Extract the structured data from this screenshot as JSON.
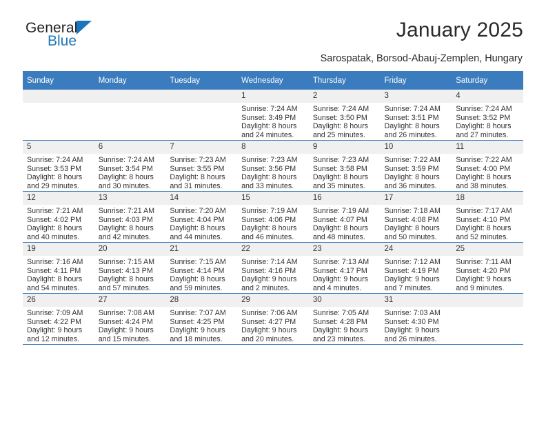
{
  "logo": {
    "word_top": "General",
    "word_bottom": "Blue",
    "triangle_color": "#1b75bb"
  },
  "header": {
    "title": "January 2025",
    "subtitle": "Sarospatak, Borsod-Abauj-Zemplen, Hungary"
  },
  "theme": {
    "header_bg": "#3b7cbe",
    "daynum_bg": "#f0f0f0",
    "text": "#333333"
  },
  "weekday_headers": [
    "Sunday",
    "Monday",
    "Tuesday",
    "Wednesday",
    "Thursday",
    "Friday",
    "Saturday"
  ],
  "weeks": [
    [
      {
        "day": "",
        "sunrise": "",
        "sunset": "",
        "daylight1": "",
        "daylight2": ""
      },
      {
        "day": "",
        "sunrise": "",
        "sunset": "",
        "daylight1": "",
        "daylight2": ""
      },
      {
        "day": "",
        "sunrise": "",
        "sunset": "",
        "daylight1": "",
        "daylight2": ""
      },
      {
        "day": "1",
        "sunrise": "Sunrise: 7:24 AM",
        "sunset": "Sunset: 3:49 PM",
        "daylight1": "Daylight: 8 hours",
        "daylight2": "and 24 minutes."
      },
      {
        "day": "2",
        "sunrise": "Sunrise: 7:24 AM",
        "sunset": "Sunset: 3:50 PM",
        "daylight1": "Daylight: 8 hours",
        "daylight2": "and 25 minutes."
      },
      {
        "day": "3",
        "sunrise": "Sunrise: 7:24 AM",
        "sunset": "Sunset: 3:51 PM",
        "daylight1": "Daylight: 8 hours",
        "daylight2": "and 26 minutes."
      },
      {
        "day": "4",
        "sunrise": "Sunrise: 7:24 AM",
        "sunset": "Sunset: 3:52 PM",
        "daylight1": "Daylight: 8 hours",
        "daylight2": "and 27 minutes."
      }
    ],
    [
      {
        "day": "5",
        "sunrise": "Sunrise: 7:24 AM",
        "sunset": "Sunset: 3:53 PM",
        "daylight1": "Daylight: 8 hours",
        "daylight2": "and 29 minutes."
      },
      {
        "day": "6",
        "sunrise": "Sunrise: 7:24 AM",
        "sunset": "Sunset: 3:54 PM",
        "daylight1": "Daylight: 8 hours",
        "daylight2": "and 30 minutes."
      },
      {
        "day": "7",
        "sunrise": "Sunrise: 7:23 AM",
        "sunset": "Sunset: 3:55 PM",
        "daylight1": "Daylight: 8 hours",
        "daylight2": "and 31 minutes."
      },
      {
        "day": "8",
        "sunrise": "Sunrise: 7:23 AM",
        "sunset": "Sunset: 3:56 PM",
        "daylight1": "Daylight: 8 hours",
        "daylight2": "and 33 minutes."
      },
      {
        "day": "9",
        "sunrise": "Sunrise: 7:23 AM",
        "sunset": "Sunset: 3:58 PM",
        "daylight1": "Daylight: 8 hours",
        "daylight2": "and 35 minutes."
      },
      {
        "day": "10",
        "sunrise": "Sunrise: 7:22 AM",
        "sunset": "Sunset: 3:59 PM",
        "daylight1": "Daylight: 8 hours",
        "daylight2": "and 36 minutes."
      },
      {
        "day": "11",
        "sunrise": "Sunrise: 7:22 AM",
        "sunset": "Sunset: 4:00 PM",
        "daylight1": "Daylight: 8 hours",
        "daylight2": "and 38 minutes."
      }
    ],
    [
      {
        "day": "12",
        "sunrise": "Sunrise: 7:21 AM",
        "sunset": "Sunset: 4:02 PM",
        "daylight1": "Daylight: 8 hours",
        "daylight2": "and 40 minutes."
      },
      {
        "day": "13",
        "sunrise": "Sunrise: 7:21 AM",
        "sunset": "Sunset: 4:03 PM",
        "daylight1": "Daylight: 8 hours",
        "daylight2": "and 42 minutes."
      },
      {
        "day": "14",
        "sunrise": "Sunrise: 7:20 AM",
        "sunset": "Sunset: 4:04 PM",
        "daylight1": "Daylight: 8 hours",
        "daylight2": "and 44 minutes."
      },
      {
        "day": "15",
        "sunrise": "Sunrise: 7:19 AM",
        "sunset": "Sunset: 4:06 PM",
        "daylight1": "Daylight: 8 hours",
        "daylight2": "and 46 minutes."
      },
      {
        "day": "16",
        "sunrise": "Sunrise: 7:19 AM",
        "sunset": "Sunset: 4:07 PM",
        "daylight1": "Daylight: 8 hours",
        "daylight2": "and 48 minutes."
      },
      {
        "day": "17",
        "sunrise": "Sunrise: 7:18 AM",
        "sunset": "Sunset: 4:08 PM",
        "daylight1": "Daylight: 8 hours",
        "daylight2": "and 50 minutes."
      },
      {
        "day": "18",
        "sunrise": "Sunrise: 7:17 AM",
        "sunset": "Sunset: 4:10 PM",
        "daylight1": "Daylight: 8 hours",
        "daylight2": "and 52 minutes."
      }
    ],
    [
      {
        "day": "19",
        "sunrise": "Sunrise: 7:16 AM",
        "sunset": "Sunset: 4:11 PM",
        "daylight1": "Daylight: 8 hours",
        "daylight2": "and 54 minutes."
      },
      {
        "day": "20",
        "sunrise": "Sunrise: 7:15 AM",
        "sunset": "Sunset: 4:13 PM",
        "daylight1": "Daylight: 8 hours",
        "daylight2": "and 57 minutes."
      },
      {
        "day": "21",
        "sunrise": "Sunrise: 7:15 AM",
        "sunset": "Sunset: 4:14 PM",
        "daylight1": "Daylight: 8 hours",
        "daylight2": "and 59 minutes."
      },
      {
        "day": "22",
        "sunrise": "Sunrise: 7:14 AM",
        "sunset": "Sunset: 4:16 PM",
        "daylight1": "Daylight: 9 hours",
        "daylight2": "and 2 minutes."
      },
      {
        "day": "23",
        "sunrise": "Sunrise: 7:13 AM",
        "sunset": "Sunset: 4:17 PM",
        "daylight1": "Daylight: 9 hours",
        "daylight2": "and 4 minutes."
      },
      {
        "day": "24",
        "sunrise": "Sunrise: 7:12 AM",
        "sunset": "Sunset: 4:19 PM",
        "daylight1": "Daylight: 9 hours",
        "daylight2": "and 7 minutes."
      },
      {
        "day": "25",
        "sunrise": "Sunrise: 7:11 AM",
        "sunset": "Sunset: 4:20 PM",
        "daylight1": "Daylight: 9 hours",
        "daylight2": "and 9 minutes."
      }
    ],
    [
      {
        "day": "26",
        "sunrise": "Sunrise: 7:09 AM",
        "sunset": "Sunset: 4:22 PM",
        "daylight1": "Daylight: 9 hours",
        "daylight2": "and 12 minutes."
      },
      {
        "day": "27",
        "sunrise": "Sunrise: 7:08 AM",
        "sunset": "Sunset: 4:24 PM",
        "daylight1": "Daylight: 9 hours",
        "daylight2": "and 15 minutes."
      },
      {
        "day": "28",
        "sunrise": "Sunrise: 7:07 AM",
        "sunset": "Sunset: 4:25 PM",
        "daylight1": "Daylight: 9 hours",
        "daylight2": "and 18 minutes."
      },
      {
        "day": "29",
        "sunrise": "Sunrise: 7:06 AM",
        "sunset": "Sunset: 4:27 PM",
        "daylight1": "Daylight: 9 hours",
        "daylight2": "and 20 minutes."
      },
      {
        "day": "30",
        "sunrise": "Sunrise: 7:05 AM",
        "sunset": "Sunset: 4:28 PM",
        "daylight1": "Daylight: 9 hours",
        "daylight2": "and 23 minutes."
      },
      {
        "day": "31",
        "sunrise": "Sunrise: 7:03 AM",
        "sunset": "Sunset: 4:30 PM",
        "daylight1": "Daylight: 9 hours",
        "daylight2": "and 26 minutes."
      },
      {
        "day": "",
        "sunrise": "",
        "sunset": "",
        "daylight1": "",
        "daylight2": ""
      }
    ]
  ]
}
